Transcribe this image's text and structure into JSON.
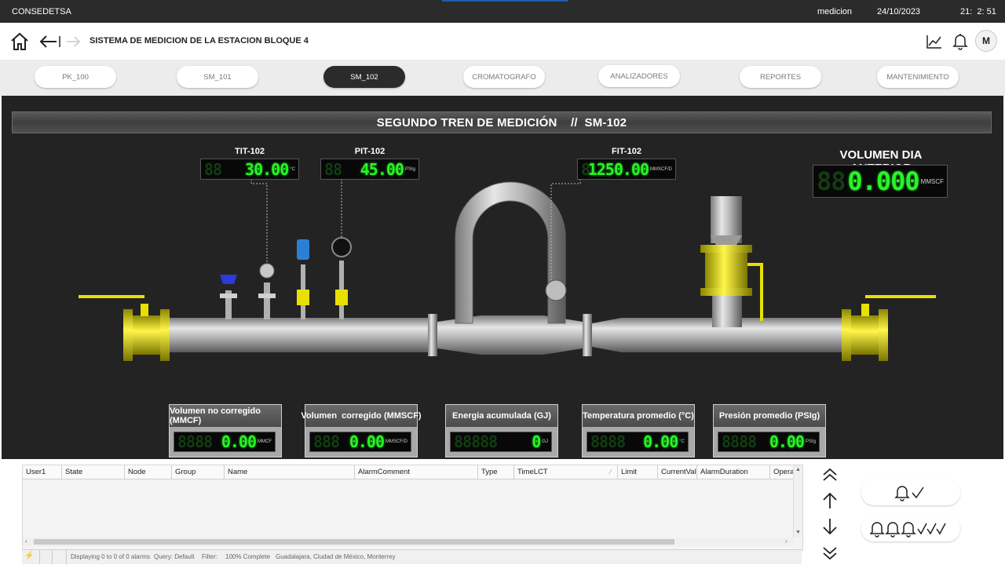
{
  "app": {
    "name": "CONSEDETSA",
    "user": "medicion",
    "date": "24/10/2023",
    "time": "21:  2: 51"
  },
  "header": {
    "title": "SISTEMA DE MEDICION DE LA ESTACION BLOQUE 4",
    "avatar_initial": "M"
  },
  "tabs": [
    {
      "label": "PK_100"
    },
    {
      "label": "SM_101"
    },
    {
      "label": "SM_102"
    },
    {
      "label": "CROMATOGRAFO"
    },
    {
      "label": "ANALIZADORES"
    },
    {
      "label": "REPORTES"
    },
    {
      "label": "MANTENIMIENTO"
    }
  ],
  "active_tab": "SM_102",
  "hmi": {
    "banner": "SEGUNDO TREN DE MEDICIÓN    //  SM-102",
    "instruments": {
      "tit": {
        "tag": "TIT-102",
        "value": "30.00",
        "ghost": "88",
        "unit": "°C"
      },
      "pit": {
        "tag": "PIT-102",
        "value": "45.00",
        "ghost": "88",
        "unit": "PSIg"
      },
      "fit": {
        "tag": "FIT-102",
        "value": "1250.00",
        "ghost": "8",
        "unit": "MMSCF/D"
      }
    },
    "volumen_dia_anterior": {
      "title": "VOLUMEN DIA ANTERIOR",
      "value": "0.000",
      "ghost": "88",
      "unit": "MMSCF"
    },
    "summaries": [
      {
        "title": "Volumen no corregido (MMCF)",
        "value": "0.00",
        "ghost": "8888",
        "unit": "MMCF"
      },
      {
        "title": "Volumen  corregido (MMSCF)",
        "value": "0.00",
        "ghost": "888",
        "unit": "MMSCF/D"
      },
      {
        "title": "Energia acumulada (GJ)",
        "value": "0",
        "ghost": "88888",
        "unit": "GJ"
      },
      {
        "title": "Temperatura promedio (°C)",
        "value": "0.00",
        "ghost": "8888",
        "unit": "°C"
      },
      {
        "title": "Presión promedio (PSIg)",
        "value": "0.00",
        "ghost": "8888",
        "unit": "PSIg"
      }
    ],
    "colors": {
      "lcd_green": "#27f427",
      "valve_yellow": "#e8e000",
      "pipe_gray": "#b5b5b5",
      "background": "#232323"
    }
  },
  "alarms": {
    "columns": [
      "User1",
      "State",
      "Node",
      "Group",
      "Name",
      "AlarmComment",
      "Type",
      "TimeLCT",
      "Limit",
      "CurrentVal",
      "AlarmDuration",
      "Opera"
    ],
    "rows": [],
    "status": {
      "displaying": "Displaying 0 to 0 of 0 alarms",
      "query": "Query: Default",
      "filter": "Filter:",
      "complete": "100% Complete",
      "location": "Guadalajara, Ciudad de México, Monterrey"
    }
  },
  "icons": [
    "home-icon",
    "back-arrow-icon",
    "forward-arrow-icon",
    "trend-chart-icon",
    "bell-icon",
    "scroll-top-icon",
    "scroll-up-icon",
    "scroll-down-icon",
    "scroll-bottom-icon",
    "ack-alarm-icon",
    "ack-all-alarms-icon"
  ]
}
